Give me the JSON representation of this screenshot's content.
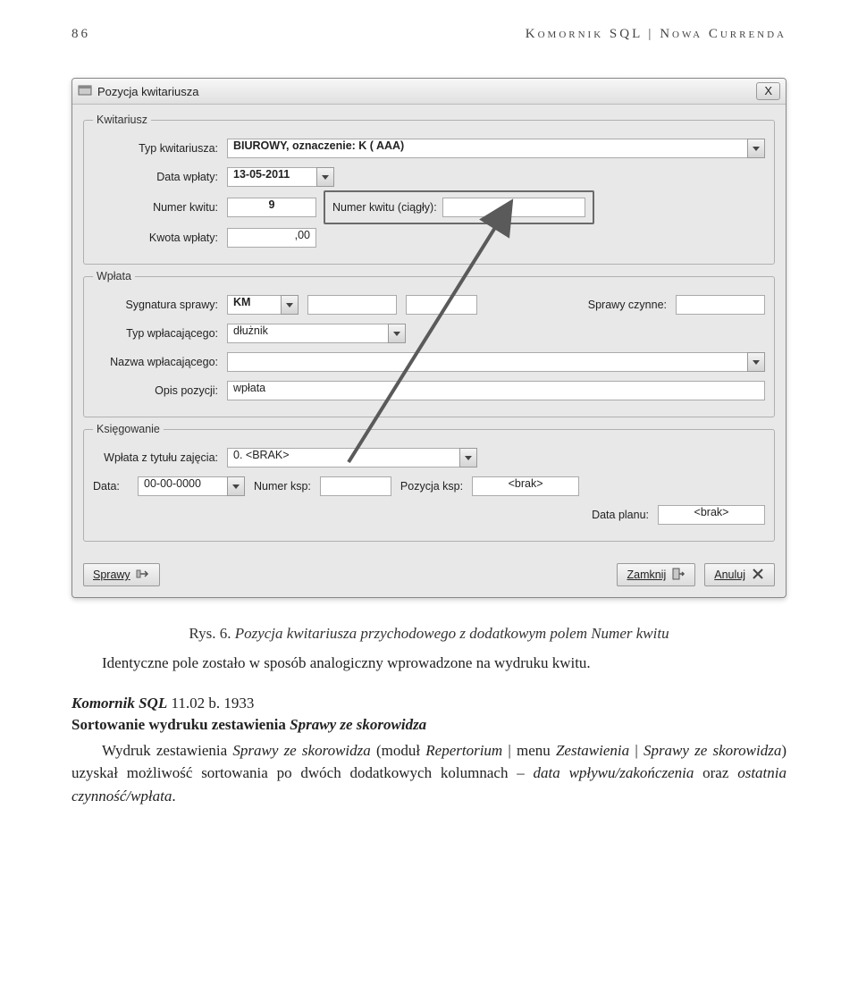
{
  "header": {
    "page_number": "86",
    "running_title": "Komornik SQL | Nowa Currenda"
  },
  "dialog": {
    "title": "Pozycja kwitariusza",
    "close": "X",
    "group_kwitariusz": {
      "legend": "Kwitariusz",
      "typ_label": "Typ kwitariusza:",
      "typ_value": "BIUROWY, oznaczenie: K ( AAA)",
      "data_wplaty_label": "Data wpłaty:",
      "data_wplaty_value": "13-05-2011",
      "numer_kwitu_label": "Numer kwitu:",
      "numer_kwitu_value": "9",
      "numer_ciagly_label": "Numer kwitu (ciągły):",
      "numer_ciagly_value": "",
      "kwota_label": "Kwota wpłaty:",
      "kwota_value": ",00"
    },
    "group_wplata": {
      "legend": "Wpłata",
      "sygnatura_label": "Sygnatura sprawy:",
      "sygnatura_value": "KM",
      "sprawy_czynne_label": "Sprawy czynne:",
      "sprawy_czynne_value": "",
      "typ_wplacajacego_label": "Typ wpłacającego:",
      "typ_wplacajacego_value": "dłużnik",
      "nazwa_label": "Nazwa wpłacającego:",
      "nazwa_value": "",
      "opis_label": "Opis pozycji:",
      "opis_value": "wpłata"
    },
    "group_ksiegowanie": {
      "legend": "Księgowanie",
      "zajecie_label": "Wpłata z tytułu zajęcia:",
      "zajecie_value": "0. <BRAK>",
      "data_label": "Data:",
      "data_value": "00-00-0000",
      "numer_ksp_label": "Numer ksp:",
      "numer_ksp_value": "",
      "pozycja_ksp_label": "Pozycja ksp:",
      "pozycja_ksp_value": "<brak>",
      "data_planu_label": "Data planu:",
      "data_planu_value": "<brak>"
    },
    "buttons": {
      "sprawy": "Sprawy",
      "zamknij": "Zamknij",
      "anuluj": "Anuluj"
    }
  },
  "caption": {
    "prefix": "Rys. 6. ",
    "text": "Pozycja kwitariusza przychodowego z dodatkowym polem Numer kwitu"
  },
  "paragraph1": "Identyczne pole zostało w sposób analogiczny wprowadzone na wydruku kwitu.",
  "heading2": {
    "bold": "Komornik SQL",
    "rest": " 11.02 b. 1933"
  },
  "subheading2": {
    "plain": "Sortowanie wydruku zestawienia ",
    "italic": "Sprawy ze skorowidza"
  },
  "paragraph2": {
    "p1": "Wydruk zestawienia ",
    "i1": "Sprawy ze skorowidza",
    "p2": " (moduł ",
    "i2": "Repertorium",
    "p3": " | menu ",
    "i3": "Zesta­wienia",
    "p4": " | ",
    "i4": "Sprawy ze skorowidza",
    "p5": ") uzyskał możliwość sortowania po dwóch dodat­kowych kolumnach – ",
    "i5": "data wpływu/zakończenia",
    "p6": " oraz ",
    "i6": "ostatnia czynność/wpłata",
    "p7": "."
  }
}
